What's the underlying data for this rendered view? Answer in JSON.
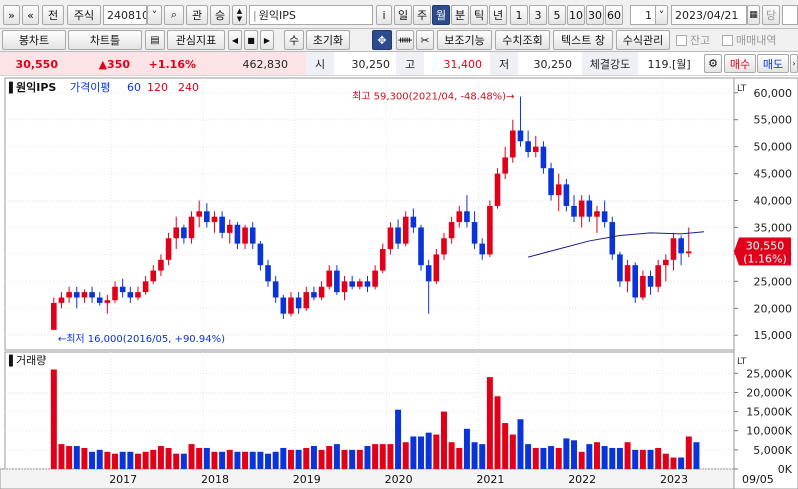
{
  "toolbar1": {
    "nav_back": "»",
    "nav_up": "«",
    "prev_label": "전",
    "market_label": "주식",
    "code_value": "240810",
    "chevron": "˅",
    "search_glyph": "⌕",
    "interest_label": "관",
    "rise_label": "승",
    "name_value": "원익IPS",
    "info_label": "i",
    "periods": [
      "일",
      "주",
      "월",
      "분",
      "틱",
      "년"
    ],
    "selected_period": "월",
    "minutes": [
      "1",
      "3",
      "5",
      "10",
      "30",
      "60"
    ],
    "count_value": "1",
    "date_value": "2023/04/21",
    "last_label": "당"
  },
  "toolbar2": {
    "items": [
      "봉차트",
      "차트틀",
      "관심지표",
      "수",
      "초기화",
      "보조기능",
      "수치조회",
      "텍스트 창",
      "수식관리"
    ],
    "checkbox1": "잔고",
    "checkbox2": "매매내역"
  },
  "quote": {
    "price": "30,550",
    "change": "▲350",
    "change_pct": "+1.16%",
    "volume": "462,830",
    "open_label": "시",
    "open": "30,250",
    "high_label": "고",
    "high": "31,400",
    "low_label": "저",
    "low": "30,250",
    "strength_label": "체결강도",
    "strength": "119.",
    "strength_unit": "[월]",
    "buy_label": "매수",
    "sell_label": "매도",
    "colors": {
      "up": "#e0001a",
      "down": "#0a34d8",
      "ma": "#1c1c8a"
    }
  },
  "chart_data": [
    {
      "type": "candlestick",
      "title": "원익IPS",
      "legend": [
        {
          "label": "가격이평",
          "color": "#0a34d8"
        },
        {
          "label": "60",
          "color": "#0a34d8"
        },
        {
          "label": "120",
          "color": "#e0001a"
        },
        {
          "label": "240",
          "color": "#e0001a"
        }
      ],
      "price_axis": {
        "min": 13000,
        "max": 62000,
        "ticks": [
          "60,000",
          "55,000",
          "50,000",
          "45,000",
          "40,000",
          "35,000",
          "30,000",
          "25,000",
          "20,000",
          "15,000"
        ],
        "tick_values": [
          60000,
          55000,
          50000,
          45000,
          40000,
          35000,
          30000,
          25000,
          20000,
          15000
        ],
        "scale_label": "LT"
      },
      "x_axis": {
        "year_labels": [
          "2017",
          "2018",
          "2019",
          "2020",
          "2021",
          "2022",
          "2023"
        ],
        "year_indices": [
          8,
          20,
          32,
          44,
          56,
          68,
          80
        ],
        "cursor_label": "09/05"
      },
      "start_label": "2016/05",
      "candles": [
        [
          16000,
          22000,
          16000,
          21000
        ],
        [
          21000,
          23000,
          20000,
          22000
        ],
        [
          22000,
          24000,
          21000,
          23000
        ],
        [
          23000,
          24000,
          20000,
          22000
        ],
        [
          22000,
          23500,
          21000,
          23000
        ],
        [
          23000,
          24000,
          21000,
          22000
        ],
        [
          22000,
          23000,
          20500,
          21000
        ],
        [
          21000,
          22500,
          19000,
          21500
        ],
        [
          21500,
          25000,
          21000,
          24000
        ],
        [
          24000,
          25500,
          22000,
          23000
        ],
        [
          23000,
          24000,
          21000,
          22000
        ],
        [
          22000,
          24000,
          21500,
          23000
        ],
        [
          23000,
          26000,
          22500,
          25000
        ],
        [
          25000,
          28000,
          24500,
          27000
        ],
        [
          27000,
          30000,
          26000,
          29000
        ],
        [
          29000,
          34000,
          28000,
          33000
        ],
        [
          33000,
          37000,
          31000,
          35000
        ],
        [
          35000,
          35500,
          32000,
          33000
        ],
        [
          33000,
          38000,
          32000,
          37000
        ],
        [
          37000,
          40000,
          35000,
          38000
        ],
        [
          38000,
          39500,
          35000,
          36000
        ],
        [
          36000,
          38000,
          34000,
          37000
        ],
        [
          37000,
          38000,
          33000,
          34000
        ],
        [
          34000,
          36500,
          32000,
          35500
        ],
        [
          35500,
          36000,
          31000,
          32000
        ],
        [
          32000,
          35500,
          31000,
          35000
        ],
        [
          35000,
          36000,
          31000,
          32000
        ],
        [
          32000,
          32500,
          27000,
          28000
        ],
        [
          28000,
          29000,
          24000,
          25000
        ],
        [
          25000,
          26000,
          21000,
          22000
        ],
        [
          22000,
          22500,
          18000,
          19000
        ],
        [
          19000,
          23000,
          18500,
          22000
        ],
        [
          22000,
          23000,
          19000,
          20000
        ],
        [
          20000,
          24000,
          19500,
          23000
        ],
        [
          23000,
          24000,
          21500,
          22000
        ],
        [
          22000,
          25000,
          21500,
          24000
        ],
        [
          24000,
          28000,
          23500,
          27000
        ],
        [
          27000,
          28000,
          22500,
          23000
        ],
        [
          23000,
          26000,
          21500,
          25000
        ],
        [
          25000,
          26000,
          23500,
          24000
        ],
        [
          24000,
          25500,
          23500,
          25000
        ],
        [
          25000,
          26000,
          23000,
          24000
        ],
        [
          24000,
          28000,
          23500,
          27000
        ],
        [
          27000,
          32000,
          26500,
          31000
        ],
        [
          31000,
          36000,
          30000,
          35000
        ],
        [
          35000,
          36500,
          31000,
          32000
        ],
        [
          32000,
          38000,
          31500,
          37000
        ],
        [
          37000,
          38500,
          34000,
          35000
        ],
        [
          35000,
          35500,
          27000,
          28000
        ],
        [
          28000,
          29000,
          19000,
          25000
        ],
        [
          25000,
          31000,
          24500,
          30000
        ],
        [
          30000,
          34000,
          29000,
          33000
        ],
        [
          33000,
          37000,
          32000,
          36000
        ],
        [
          36000,
          39000,
          35000,
          38000
        ],
        [
          38000,
          41000,
          35000,
          36000
        ],
        [
          36000,
          38000,
          31000,
          32000
        ],
        [
          32000,
          33000,
          29000,
          30000
        ],
        [
          30000,
          40000,
          29500,
          39000
        ],
        [
          39000,
          46000,
          38500,
          45000
        ],
        [
          45000,
          50000,
          44000,
          48000
        ],
        [
          48000,
          55000,
          47000,
          53000
        ],
        [
          53000,
          59300,
          50000,
          51000
        ],
        [
          51000,
          53000,
          48000,
          49000
        ],
        [
          49000,
          52000,
          48000,
          50000
        ],
        [
          50000,
          51000,
          45000,
          46000
        ],
        [
          46000,
          47000,
          40000,
          41000
        ],
        [
          41000,
          45000,
          38000,
          43000
        ],
        [
          43000,
          44000,
          38000,
          39000
        ],
        [
          39000,
          41000,
          36000,
          37000
        ],
        [
          37000,
          41000,
          35000,
          40000
        ],
        [
          40000,
          41000,
          36000,
          37000
        ],
        [
          37000,
          39000,
          34000,
          38000
        ],
        [
          38000,
          40000,
          35000,
          36000
        ],
        [
          36000,
          37000,
          29000,
          30000
        ],
        [
          30000,
          30500,
          24000,
          25000
        ],
        [
          25000,
          29000,
          23000,
          28000
        ],
        [
          28000,
          28500,
          21000,
          22000
        ],
        [
          22000,
          27000,
          21500,
          26000
        ],
        [
          26000,
          27000,
          22500,
          24000
        ],
        [
          24000,
          29000,
          23000,
          28000
        ],
        [
          28000,
          30000,
          25000,
          29000
        ],
        [
          29000,
          34000,
          27000,
          33000
        ],
        [
          33000,
          33500,
          28000,
          30200
        ],
        [
          30200,
          35000,
          29500,
          30550
        ]
      ],
      "ma60": [
        [
          62,
          29500
        ],
        [
          66,
          31000
        ],
        [
          70,
          32500
        ],
        [
          74,
          33500
        ],
        [
          78,
          34000
        ],
        [
          82,
          33800
        ],
        [
          85,
          34200
        ]
      ],
      "annotations": {
        "high_text": "최고 59,300(2021/04, -48.48%)",
        "high_arrow": "→",
        "low_text": "←최저 16,000(2016/05, +90.94%)"
      },
      "price_tag": {
        "price": "30,550",
        "pct": "(1.16%)"
      }
    },
    {
      "type": "bar",
      "title": "거래량",
      "volume_axis": {
        "min": 0,
        "max": 29000,
        "ticks": [
          "25,000K",
          "20,000K",
          "15,000K",
          "10,000K",
          "5,000K",
          "0K"
        ],
        "tick_values": [
          25000,
          20000,
          15000,
          10000,
          5000,
          0
        ],
        "scale_label": "LT"
      },
      "unit": "K",
      "values": [
        26000,
        6500,
        6000,
        6000,
        5500,
        4500,
        5000,
        4500,
        4000,
        4500,
        4500,
        4000,
        4500,
        5000,
        6000,
        5500,
        4000,
        4000,
        6500,
        5500,
        5500,
        4500,
        4500,
        5000,
        4500,
        4500,
        4500,
        4500,
        4000,
        4500,
        5500,
        5000,
        5000,
        5500,
        6000,
        5000,
        6000,
        6500,
        5000,
        5000,
        5000,
        6000,
        6500,
        6500,
        6500,
        15500,
        7000,
        8500,
        8500,
        9500,
        9000,
        15000,
        7000,
        5500,
        10500,
        7000,
        6500,
        24000,
        19000,
        12000,
        9000,
        13000,
        6500,
        5500,
        5500,
        6000,
        5500,
        8000,
        7500,
        4500,
        6500,
        7000,
        6000,
        5500,
        5500,
        7000,
        5000,
        5000,
        5000,
        5500,
        4000,
        3000,
        3000,
        8500,
        7000
      ]
    }
  ]
}
